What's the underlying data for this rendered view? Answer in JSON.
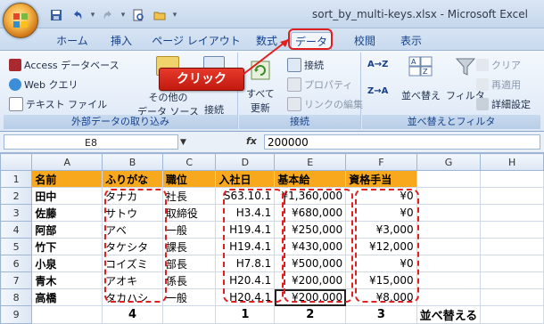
{
  "window": {
    "title": "sort_by_multi-keys.xlsx - Microsoft Excel"
  },
  "qat": {
    "separator": "▾"
  },
  "tabs": [
    "ホーム",
    "挿入",
    "ページ レイアウト",
    "数式",
    "データ",
    "校閲",
    "表示"
  ],
  "active_tab": "データ",
  "ribbon": {
    "external": {
      "label": "外部データの取り込み",
      "access": "Access データベース",
      "web": "Web クエリ",
      "text": "テキスト ファイル",
      "other_line1": "その他の",
      "other_line2": "データ ソース",
      "existing": "接続"
    },
    "connections": {
      "label": "接続",
      "refresh_line1": "すべて",
      "refresh_line2": "更新",
      "connections": "接続",
      "properties": "プロパティ",
      "edit_links": "リンクの編集"
    },
    "sort_filter": {
      "label": "並べ替えとフィルタ",
      "az": "A→Z",
      "za": "Z→A",
      "sort": "並べ替え",
      "filter": "フィルタ",
      "clear": "クリア",
      "reapply": "再適用",
      "advanced": "詳細設定"
    }
  },
  "callout": {
    "text": "クリック"
  },
  "formula_bar": {
    "name_box": "E8",
    "fx": "fx",
    "value": "200000"
  },
  "sheet": {
    "columns": [
      "A",
      "B",
      "C",
      "D",
      "E",
      "F",
      "G",
      "H"
    ],
    "rows": [
      [
        "名前",
        "ふりがな",
        "職位",
        "入社日",
        "基本給",
        "資格手当",
        "",
        ""
      ],
      [
        "田中",
        "タナカ",
        "社長",
        "S63.10.1",
        "¥1,360,000",
        "¥0",
        "",
        ""
      ],
      [
        "佐藤",
        "サトウ",
        "取締役",
        "H3.4.1",
        "¥680,000",
        "¥0",
        "",
        ""
      ],
      [
        "阿部",
        "アベ",
        "一般",
        "H19.4.1",
        "¥250,000",
        "¥3,000",
        "",
        ""
      ],
      [
        "竹下",
        "タケシタ",
        "課長",
        "H19.4.1",
        "¥430,000",
        "¥12,000",
        "",
        ""
      ],
      [
        "小泉",
        "コイズミ",
        "部長",
        "H7.8.1",
        "¥500,000",
        "¥0",
        "",
        ""
      ],
      [
        "青木",
        "アオキ",
        "係長",
        "H20.4.1",
        "¥200,000",
        "¥15,000",
        "",
        ""
      ],
      [
        "高橋",
        "タカハシ",
        "一般",
        "H20.4.1",
        "¥200,000",
        "¥8,000",
        "",
        ""
      ],
      [
        "",
        "4",
        "",
        "1",
        "2",
        "3",
        "並べ替える",
        ""
      ]
    ]
  },
  "colors": {
    "header_fill": "#f7a81c",
    "highlight": "#e02020",
    "ribbon_text": "#15428b"
  }
}
